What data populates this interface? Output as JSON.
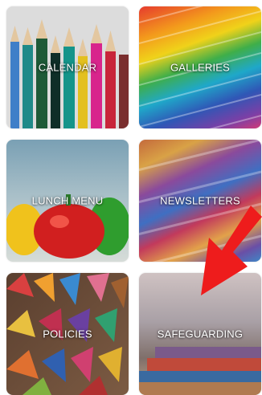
{
  "tiles": [
    {
      "label": "CALENDAR"
    },
    {
      "label": "GALLERIES"
    },
    {
      "label": "LUNCH MENU"
    },
    {
      "label": "NEWSLETTERS"
    },
    {
      "label": "POLICIES"
    },
    {
      "label": "SAFEGUARDING"
    }
  ],
  "colors": {
    "label_text": "#ffffff",
    "arrow": "#ee1c1c"
  },
  "icons": {
    "pointer": "red-arrow-icon"
  }
}
